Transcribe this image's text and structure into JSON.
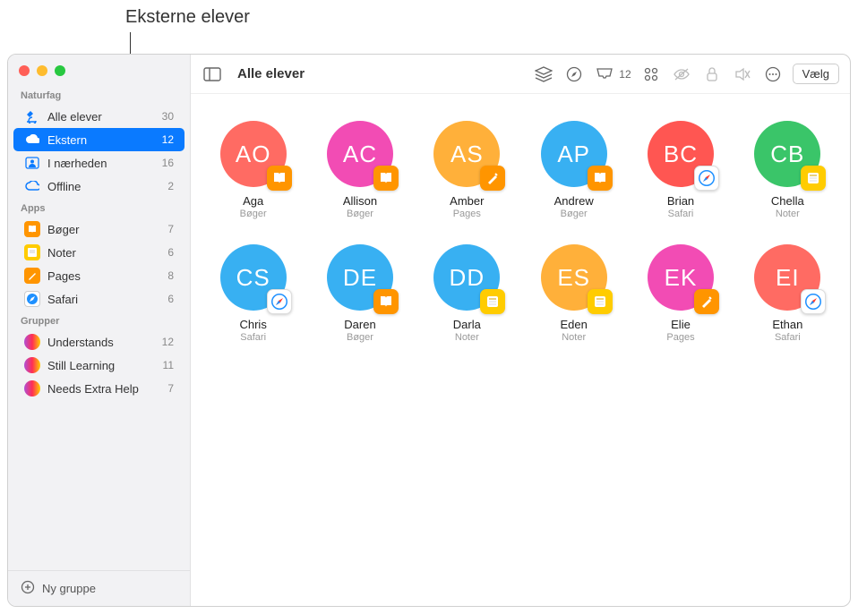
{
  "callout": "Eksterne elever",
  "sidebar": {
    "sections": [
      {
        "header": "Naturfag",
        "items": [
          {
            "icon": "microscope",
            "iconColor": "#0a7aff",
            "label": "Alle elever",
            "count": 30,
            "selected": false
          },
          {
            "icon": "cloud",
            "iconColor": "#0a7aff",
            "label": "Ekstern",
            "count": 12,
            "selected": true
          },
          {
            "icon": "person",
            "iconColor": "#0a7aff",
            "label": "I nærheden",
            "count": 16,
            "selected": false
          },
          {
            "icon": "cloud-off",
            "iconColor": "#0a7aff",
            "label": "Offline",
            "count": 2,
            "selected": false
          }
        ]
      },
      {
        "header": "Apps",
        "items": [
          {
            "icon": "app-books",
            "label": "Bøger",
            "count": 7
          },
          {
            "icon": "app-notes",
            "label": "Noter",
            "count": 6
          },
          {
            "icon": "app-pages",
            "label": "Pages",
            "count": 8
          },
          {
            "icon": "app-safari",
            "label": "Safari",
            "count": 6
          }
        ]
      },
      {
        "header": "Grupper",
        "items": [
          {
            "icon": "group",
            "label": "Understands",
            "count": 12
          },
          {
            "icon": "group",
            "label": "Still Learning",
            "count": 11
          },
          {
            "icon": "group",
            "label": "Needs Extra Help",
            "count": 7
          }
        ]
      }
    ],
    "footer": "Ny gruppe"
  },
  "toolbar": {
    "title": "Alle elever",
    "inboxCount": 12,
    "selectButton": "Vælg"
  },
  "students": [
    {
      "initials": "AO",
      "color": "c-coral",
      "name": "Aga",
      "app": "Bøger",
      "badge": "b-books"
    },
    {
      "initials": "AC",
      "color": "c-pink",
      "name": "Allison",
      "app": "Bøger",
      "badge": "b-books"
    },
    {
      "initials": "AS",
      "color": "c-orange",
      "name": "Amber",
      "app": "Pages",
      "badge": "b-pages"
    },
    {
      "initials": "AP",
      "color": "c-blue",
      "name": "Andrew",
      "app": "Bøger",
      "badge": "b-books"
    },
    {
      "initials": "BC",
      "color": "c-red",
      "name": "Brian",
      "app": "Safari",
      "badge": "b-safari"
    },
    {
      "initials": "CB",
      "color": "c-green",
      "name": "Chella",
      "app": "Noter",
      "badge": "b-notes"
    },
    {
      "initials": "CS",
      "color": "c-blue",
      "name": "Chris",
      "app": "Safari",
      "badge": "b-safari"
    },
    {
      "initials": "DE",
      "color": "c-blue",
      "name": "Daren",
      "app": "Bøger",
      "badge": "b-books"
    },
    {
      "initials": "DD",
      "color": "c-blue",
      "name": "Darla",
      "app": "Noter",
      "badge": "b-notes"
    },
    {
      "initials": "ES",
      "color": "c-orange",
      "name": "Eden",
      "app": "Noter",
      "badge": "b-notes"
    },
    {
      "initials": "EK",
      "color": "c-pink",
      "name": "Elie",
      "app": "Pages",
      "badge": "b-pages"
    },
    {
      "initials": "EI",
      "color": "c-coral",
      "name": "Ethan",
      "app": "Safari",
      "badge": "b-safari"
    }
  ]
}
